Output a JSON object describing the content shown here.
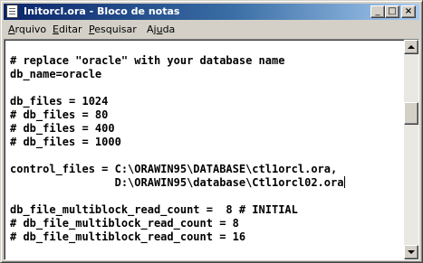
{
  "window": {
    "title": "Initorcl.ora - Bloco de notas",
    "controls": {
      "minimize": "_",
      "maximize": "□",
      "close": "×"
    }
  },
  "menu": {
    "items": [
      {
        "label_first": "A",
        "label_rest": "rquivo"
      },
      {
        "label_first": "E",
        "label_rest": "ditar"
      },
      {
        "label_first": "P",
        "label_rest": "esquisar"
      },
      {
        "label_prefix": "Aj",
        "label_first": "u",
        "label_rest": "da"
      }
    ]
  },
  "editor": {
    "lines": [
      "# replace \"oracle\" with your database name",
      "db_name=oracle",
      "",
      "db_files = 1024",
      "# db_files = 80",
      "# db_files = 400",
      "# db_files = 1000",
      "",
      "control_files = C:\\ORAWIN95\\DATABASE\\ctl1orcl.ora,",
      "                D:\\ORAWIN95\\database\\Ctl1orcl02.ora",
      "",
      "db_file_multiblock_read_count =  8 # INITIAL",
      "# db_file_multiblock_read_count = 8",
      "# db_file_multiblock_read_count = 16"
    ]
  },
  "scrollbar": {
    "position_fraction": 0.25
  },
  "colors": {
    "title_active_start": "#0a246a",
    "title_active_end": "#a6caf0",
    "face": "#d4d0c8",
    "editor_bg": "#ffffff"
  },
  "icons": {
    "app": "notepad-icon",
    "scroll_up": "arrow-up-icon",
    "scroll_down": "arrow-down-icon"
  }
}
